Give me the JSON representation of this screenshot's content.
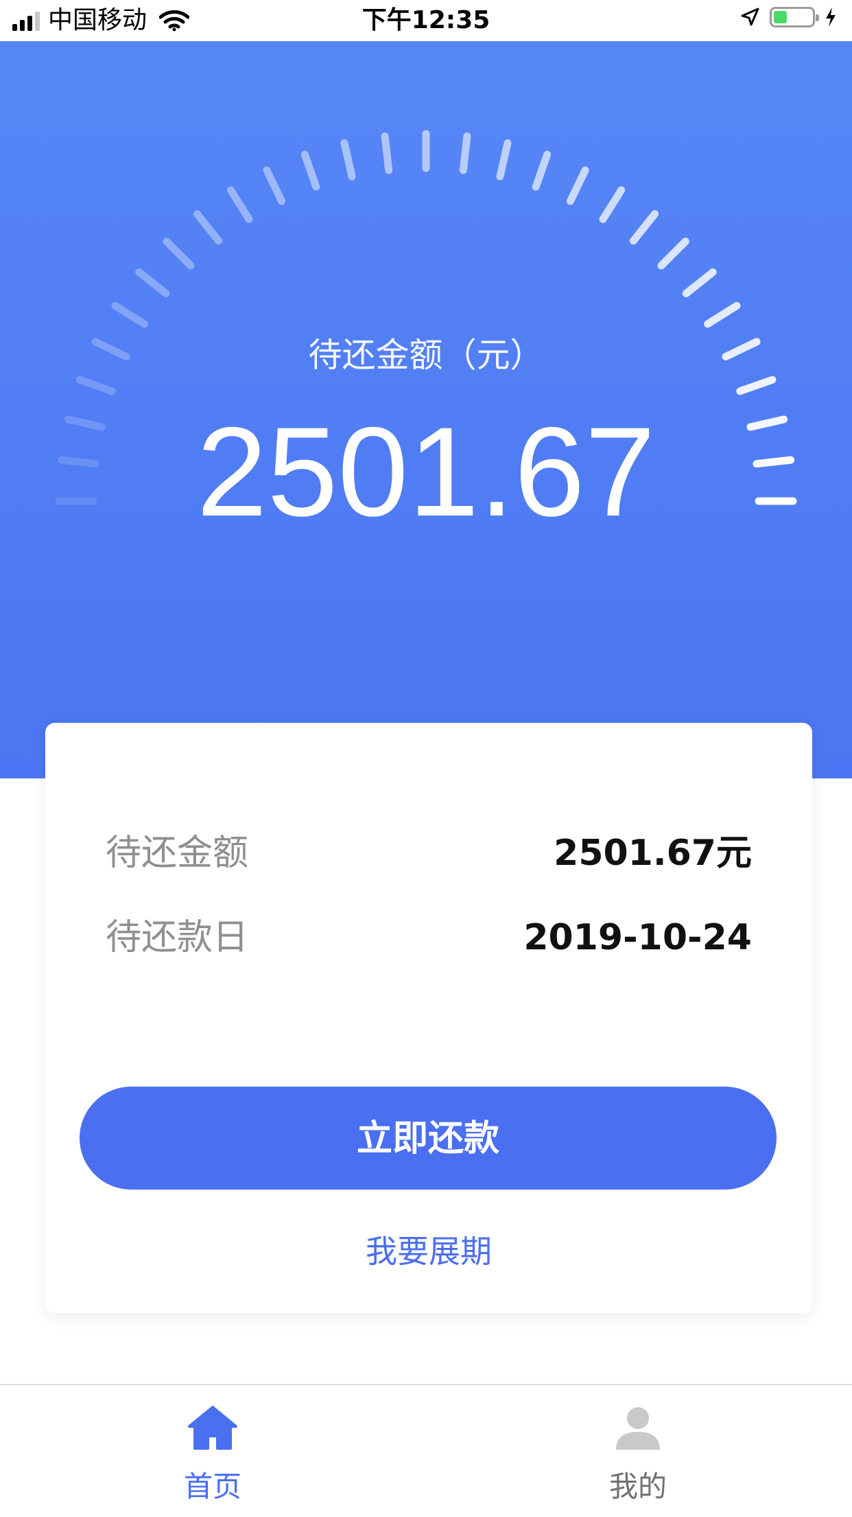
{
  "status_bar": {
    "carrier": "中国移动",
    "time": "下午12:35",
    "battery_level": 0.35
  },
  "hero": {
    "label": "待还金额（元）",
    "amount": "2501.67"
  },
  "card": {
    "rows": [
      {
        "label": "待还金额",
        "value": "2501.67元"
      },
      {
        "label": "待还款日",
        "value": "2019-10-24"
      }
    ],
    "primary_button": "立即还款",
    "link": "我要展期"
  },
  "tabbar": {
    "tabs": [
      {
        "label": "首页",
        "active": true
      },
      {
        "label": "我的",
        "active": false
      }
    ]
  },
  "colors": {
    "brand": "#4a6ff0",
    "hero_top": "#5787f6",
    "hero_bottom": "#4b75f2"
  }
}
